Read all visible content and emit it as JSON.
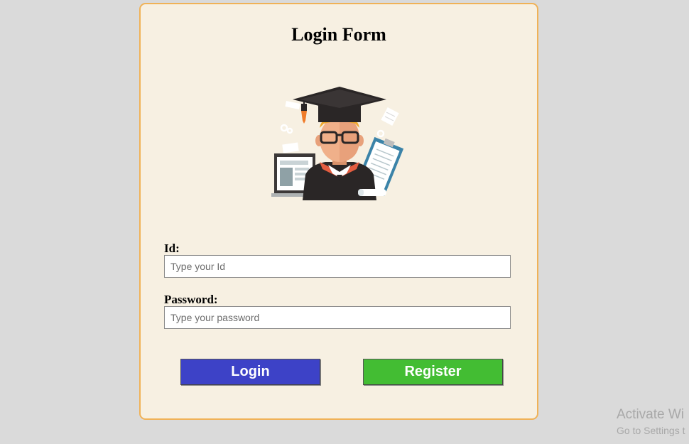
{
  "form": {
    "title": "Login Form",
    "id_label": "Id:",
    "id_placeholder": "Type your Id",
    "password_label": "Password:",
    "password_placeholder": "Type your password",
    "login_label": "Login",
    "register_label": "Register"
  },
  "watermark": {
    "title": "Activate Wi",
    "subtitle": "Go to Settings t"
  },
  "colors": {
    "page_background": "#dadada",
    "card_background": "#f7f0e2",
    "card_border": "#f0b257",
    "login_button": "#3d42c7",
    "register_button": "#43bd33"
  },
  "icons": {
    "illustration": "graduate-student-illustration"
  }
}
